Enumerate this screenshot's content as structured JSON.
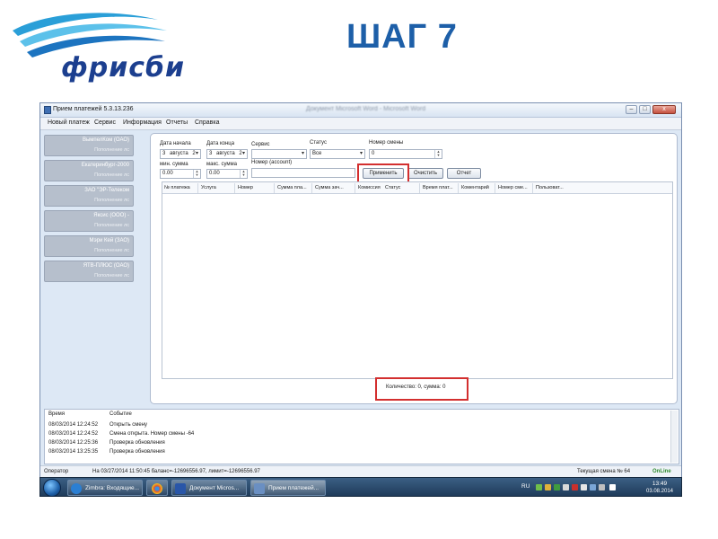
{
  "slide": {
    "title": "ШАГ 7",
    "logo_text": "фрисби"
  },
  "window": {
    "title": "Прием платежей 5.3.13.236",
    "blurred_title": "Документ Microsoft Word - Microsoft Word",
    "controls": [
      "–",
      "□",
      "x"
    ]
  },
  "menu": [
    "Новый платеж",
    "Сервис",
    "Информация",
    "Отчеты",
    "Справка"
  ],
  "sidebar": [
    {
      "name": "ВымпелКом (ОАО)",
      "sub": "Пополнение лс"
    },
    {
      "name": "Екатеринбург-2000",
      "sub": "Пополнение лс"
    },
    {
      "name": "ЗАО \"ЭР-Телеком",
      "sub": "Пополнение лс"
    },
    {
      "name": "Яксис (ООО) -",
      "sub": "Пополнение лс"
    },
    {
      "name": "Мэри Кей (ЗАО)",
      "sub": "Пополнение лс"
    },
    {
      "name": "ЯТВ-ПЛЮС (ОАО)",
      "sub": "Пополнение лс"
    }
  ],
  "filters": {
    "start_date_label": "Дата начала",
    "start_day": "3",
    "start_month": "августа",
    "start_year_part": "2",
    "end_date_label": "Дата конца",
    "end_day": "3",
    "end_month": "августа",
    "end_year_part": "2",
    "service_label": "Сервис",
    "service_value": "",
    "status_label": "Статус",
    "status_value": "Все",
    "shift_label": "Номер смены",
    "shift_value": "0",
    "min_sum_label": "мин. сумма",
    "min_sum_value": "0.00",
    "max_sum_label": "макс. сумма",
    "max_sum_value": "0.00",
    "account_label": "Номер (account)",
    "account_value": ""
  },
  "buttons": {
    "apply": "Применить",
    "clear": "Очистить",
    "report": "Отчет"
  },
  "columns": [
    "№ платежа",
    "Услуга",
    "Номер",
    "Сумма пла...",
    "Сумма зач...",
    "Комиссия",
    "Статус",
    "Время плат...",
    "Коментарий",
    "Номер сме...",
    "Пользоват..."
  ],
  "summary": "Количество: 0, сумма: 0",
  "log": {
    "col_time": "Время",
    "col_event": "Событие",
    "rows": [
      {
        "time": "08/03/2014 12:24:52",
        "event": "Открыть смену"
      },
      {
        "time": "08/03/2014 12:24:52",
        "event": "Смена открыта. Номер смены -64"
      },
      {
        "time": "08/03/2014 12:25:36",
        "event": "Проверка обновления"
      },
      {
        "time": "08/03/2014 13:25:35",
        "event": "Проверка обновления"
      }
    ]
  },
  "status": {
    "operator_label": "Оператор",
    "balance_text": "На 03/27/2014 11:50:45 баланс=-12696556.97, лимит=-12696556.97",
    "shift_text": "Текущая смена № 64",
    "online_text": "OnLine"
  },
  "taskbar": {
    "tasks": [
      {
        "label": "Zimbra: Входящие...",
        "color": "#2b7fd3"
      },
      {
        "label": "",
        "color": "#e04a2c"
      },
      {
        "label": "Документ Micros...",
        "color": "#2956a8"
      },
      {
        "label": "Прием платежей...",
        "color": "#6a8fc2"
      }
    ],
    "lang": "RU",
    "time": "13:49",
    "date": "03.08.2014"
  }
}
